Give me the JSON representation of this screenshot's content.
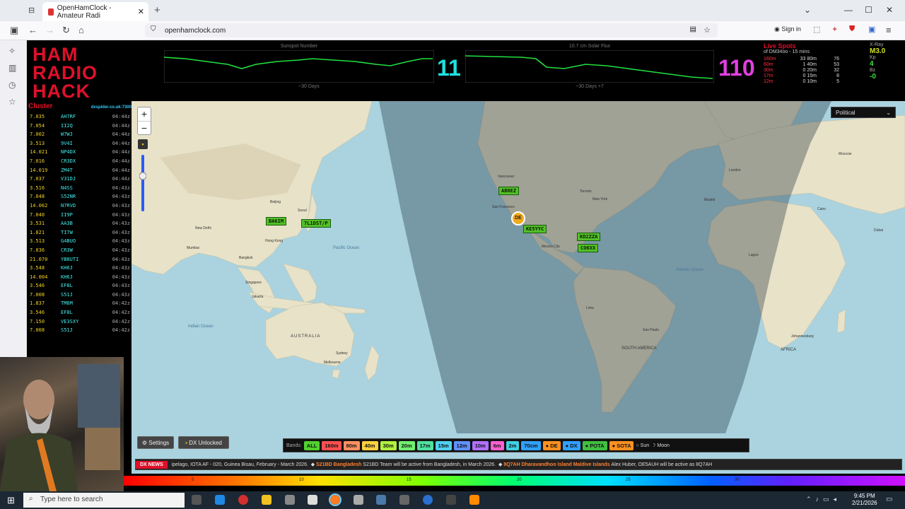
{
  "browser": {
    "tab_title": "OpenHamClock - Amateur Radi",
    "url": "openhamclock.com",
    "sign_in": "Sign in"
  },
  "app": {
    "logo_lines": [
      "HAM",
      "RADIO",
      "HACK"
    ],
    "sunspot": {
      "label": "Sunspot Number",
      "sub": "~30 Days",
      "value": "11"
    },
    "solar_flux": {
      "label": "10.7 cm Solar Flux",
      "sub": "~30 Days +7",
      "value": "110"
    },
    "live_spots": {
      "title": "Live Spots",
      "subtitle": "of DM34oo - 15 mins",
      "rows": [
        {
          "band": "160m",
          "count": "33 80m",
          "n": "76"
        },
        {
          "band": "60m",
          "count": "1 40m",
          "n": "53"
        },
        {
          "band": "30m",
          "count": "0 20m",
          "n": "32"
        },
        {
          "band": "17m",
          "count": "0 15m",
          "n": "8"
        },
        {
          "band": "12m",
          "count": "0 10m",
          "n": "5"
        }
      ]
    },
    "space_wx": {
      "xray_label": "X-Ray",
      "xray": "M3.0",
      "kp_label": "Kp",
      "kp": "4",
      "bz_label": "Bz",
      "bz": "-0"
    }
  },
  "cluster": {
    "title": "Cluster",
    "source": "dxspider.co.uk:7300",
    "rows": [
      {
        "f": "7.035",
        "c": "AH7RF",
        "t": "04:44z"
      },
      {
        "f": "7.054",
        "c": "II2Q",
        "t": "04:44z"
      },
      {
        "f": "7.002",
        "c": "W7WJ",
        "t": "04:44z"
      },
      {
        "f": "3.513",
        "c": "9V4I",
        "t": "04:44z"
      },
      {
        "f": "14.021",
        "c": "NP4DX",
        "t": "04:44z"
      },
      {
        "f": "7.016",
        "c": "CR3DX",
        "t": "04:44z"
      },
      {
        "f": "14.019",
        "c": "ZM4T",
        "t": "04:44z"
      },
      {
        "f": "7.037",
        "c": "V31DJ",
        "t": "04:44z"
      },
      {
        "f": "3.516",
        "c": "N4SS",
        "t": "04:43z"
      },
      {
        "f": "7.048",
        "c": "S52NR",
        "t": "04:43z"
      },
      {
        "f": "14.062",
        "c": "N7RVD",
        "t": "04:43z"
      },
      {
        "f": "7.040",
        "c": "II9P",
        "t": "04:43z"
      },
      {
        "f": "3.531",
        "c": "AA3B",
        "t": "04:43z"
      },
      {
        "f": "1.821",
        "c": "TI7W",
        "t": "04:43z"
      },
      {
        "f": "3.513",
        "c": "G4BUO",
        "t": "04:43z"
      },
      {
        "f": "7.036",
        "c": "CR3W",
        "t": "04:43z"
      },
      {
        "f": "21.070",
        "c": "YB8UTI",
        "t": "04:43z"
      },
      {
        "f": "3.548",
        "c": "KH6J",
        "t": "04:43z"
      },
      {
        "f": "14.004",
        "c": "KH6J",
        "t": "04:43z"
      },
      {
        "f": "3.546",
        "c": "EF8L",
        "t": "04:43z"
      },
      {
        "f": "7.008",
        "c": "S51J",
        "t": "04:43z"
      },
      {
        "f": "1.837",
        "c": "TM6M",
        "t": "04:42z"
      },
      {
        "f": "3.546",
        "c": "EF8L",
        "t": "04:42z"
      },
      {
        "f": "7.150",
        "c": "VE3SXY",
        "t": "04:42z"
      },
      {
        "f": "7.008",
        "c": "S51J",
        "t": "04:42z"
      }
    ]
  },
  "map": {
    "layer": "Political",
    "de_label": "DE",
    "spots": [
      {
        "label": "AB0EZ"
      },
      {
        "label": "KE5YYC"
      },
      {
        "label": "KD2ZZA"
      },
      {
        "label": "CO6XX"
      },
      {
        "label": "BA6IM"
      },
      {
        "label": "7L1DST/P"
      }
    ],
    "cities": [
      "Vancouver",
      "San Francisco",
      "Mexico City",
      "Toronto",
      "New York",
      "Beijing",
      "Seoul",
      "New Delhi",
      "Mumbai",
      "Hong Kong",
      "Bangkok",
      "Singapore",
      "Jakarta",
      "Sydney",
      "Melbourne",
      "Madrid",
      "Cairo",
      "Lagos",
      "Johannesburg",
      "Sao Paulo",
      "Lima",
      "London",
      "Moscow",
      "Dubai"
    ],
    "continents": [
      "AUSTRALIA",
      "SOUTH AMERICA",
      "AFRICA"
    ],
    "oceans": [
      "Pacific Ocean",
      "Indian Ocean",
      "Atlantic Ocean"
    ]
  },
  "controls": {
    "settings": "Settings",
    "dx_unlocked": "DX Unlocked",
    "bands_label": "Bands:",
    "bands": [
      {
        "label": "ALL",
        "color": "#52d030"
      },
      {
        "label": "160m",
        "color": "#ff5050"
      },
      {
        "label": "80m",
        "color": "#ff9060"
      },
      {
        "label": "40m",
        "color": "#ffd040"
      },
      {
        "label": "30m",
        "color": "#b0f040"
      },
      {
        "label": "20m",
        "color": "#70f070"
      },
      {
        "label": "17m",
        "color": "#50e0a0"
      },
      {
        "label": "15m",
        "color": "#50d0f0"
      },
      {
        "label": "12m",
        "color": "#6090ff"
      },
      {
        "label": "10m",
        "color": "#b070ff"
      },
      {
        "label": "6m",
        "color": "#ff60d0"
      },
      {
        "label": "2m",
        "color": "#40d0e0"
      },
      {
        "label": "70cm",
        "color": "#30a0ff"
      }
    ],
    "toggles": [
      "DE",
      "DX",
      "POTA",
      "SOTA",
      "Sun",
      "Moon"
    ]
  },
  "news": {
    "tag": "DX NEWS",
    "text1": "ipelago, IOTA AF - 020, Guinea Bisau, February - March 2026.",
    "call1": "S21BD Bangladesh",
    "text2": "S21BD Team will be active from Bangladesh, in March 2026.",
    "call2": "8Q7AH Dharavandhoo Island Maldive Islands",
    "text3": "Alex Huber, OE5AUH will be active as 8Q7AH"
  },
  "scale": [
    "5",
    "10",
    "15",
    "20",
    "25",
    "30"
  ],
  "taskbar": {
    "search": "Type here to search",
    "time": "9:45 PM",
    "date": "2/21/2026"
  }
}
